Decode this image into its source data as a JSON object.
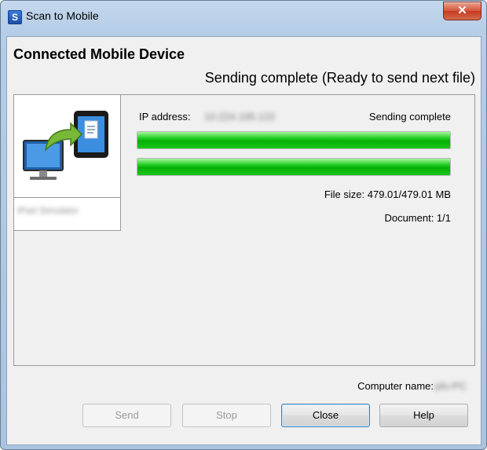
{
  "window": {
    "title": "Scan to Mobile",
    "close_glyph": "✕"
  },
  "app_icon": {
    "glyph": "S",
    "name": "scansnap-icon"
  },
  "header": {
    "title": "Connected Mobile Device",
    "status": "Sending complete (Ready to send next file)"
  },
  "device": {
    "name": "iPad Simulator",
    "ip_label": "IP address:",
    "ip_value": "10.224.195.122",
    "send_status": "Sending complete",
    "file_progress": 1.0,
    "total_progress": 1.0,
    "file_size": "File size: 479.01/479.01 MB",
    "document": "Document: 1/1"
  },
  "footer": {
    "computer_label": "Computer name:",
    "computer_value": "pfu-PC"
  },
  "buttons": {
    "send": "Send",
    "stop": "Stop",
    "close": "Close",
    "help": "Help"
  },
  "colors": {
    "progress_green": "#06b106",
    "close_red": "#c53a22",
    "window_frame": "#b5cde6"
  }
}
